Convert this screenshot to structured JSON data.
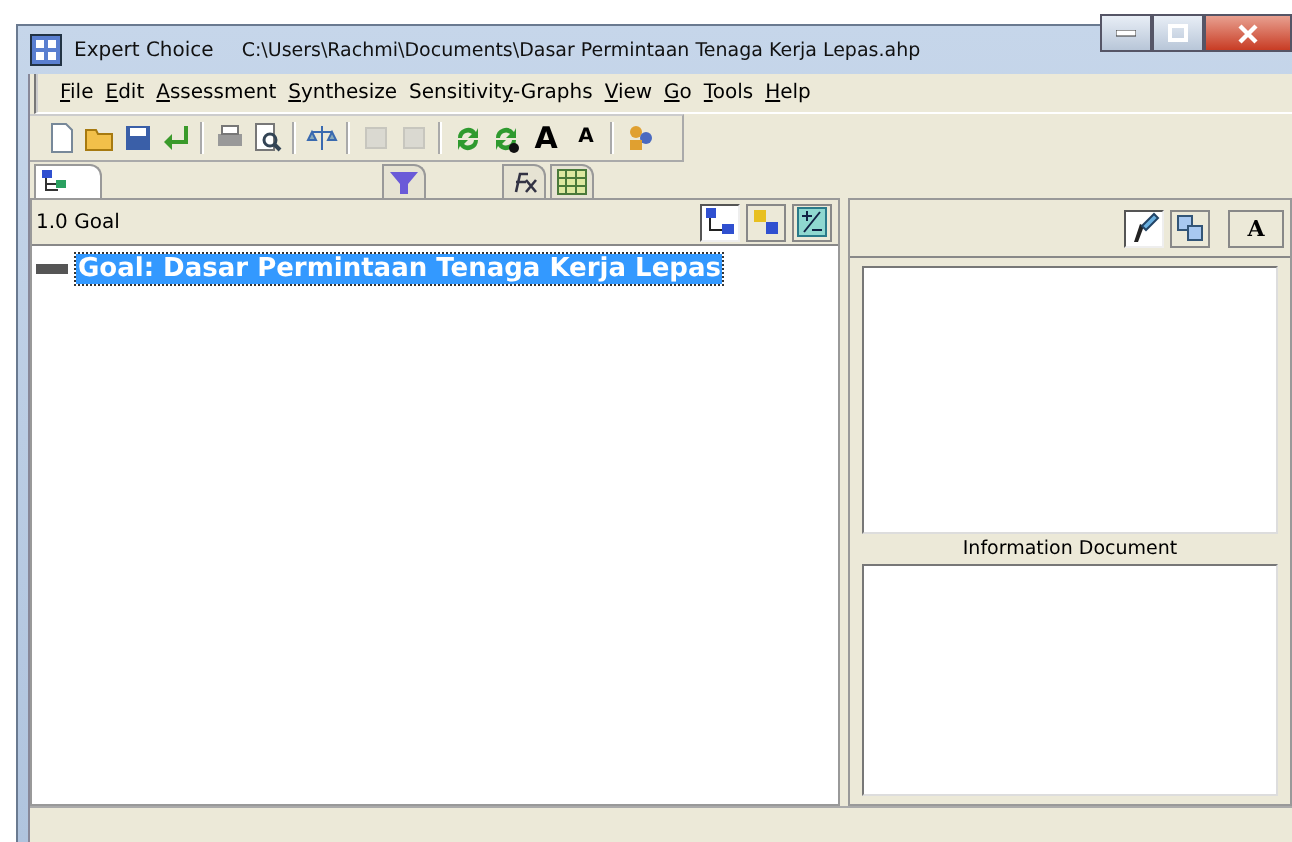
{
  "window": {
    "title": "Expert Choice",
    "path": "C:\\Users\\Rachmi\\Documents\\Dasar Permintaan Tenaga Kerja Lepas.ahp"
  },
  "menu": [
    {
      "key": "F",
      "after": "ile"
    },
    {
      "key": "E",
      "after": "dit"
    },
    {
      "key": "A",
      "after": "ssessment"
    },
    {
      "key": "S",
      "after": "ynthesize"
    },
    {
      "before": "Sensitivit",
      "key": "y",
      "after": "-Graphs"
    },
    {
      "key": "V",
      "after": "iew"
    },
    {
      "key": "G",
      "after": "o"
    },
    {
      "key": "T",
      "after": "ools"
    },
    {
      "key": "H",
      "after": "elp"
    }
  ],
  "toolbar": [
    {
      "kind": "new",
      "disabled": false
    },
    {
      "kind": "open",
      "disabled": false
    },
    {
      "kind": "save",
      "disabled": false
    },
    {
      "kind": "enter",
      "disabled": false
    },
    {
      "kind": "sep"
    },
    {
      "kind": "print",
      "disabled": false
    },
    {
      "kind": "preview",
      "disabled": false
    },
    {
      "kind": "sep"
    },
    {
      "kind": "balance",
      "disabled": false
    },
    {
      "kind": "sep"
    },
    {
      "kind": "cut",
      "disabled": true
    },
    {
      "kind": "paste",
      "disabled": true
    },
    {
      "kind": "sep"
    },
    {
      "kind": "refresh",
      "disabled": false
    },
    {
      "kind": "refresh2",
      "disabled": false
    },
    {
      "kind": "font",
      "glyph": "A",
      "big": true,
      "disabled": false
    },
    {
      "kind": "font",
      "glyph": "A",
      "big": false,
      "disabled": false
    },
    {
      "kind": "sep"
    },
    {
      "kind": "users",
      "disabled": false
    }
  ],
  "tabs": [
    {
      "kind": "tree",
      "selected": true
    },
    {
      "kind": "funnel",
      "selected": false
    },
    {
      "kind": "formula",
      "selected": false
    },
    {
      "kind": "grid",
      "selected": false
    }
  ],
  "left": {
    "node_label": "1.0 Goal",
    "buttons": [
      {
        "kind": "tree",
        "pressed": true
      },
      {
        "kind": "nodes",
        "pressed": false
      },
      {
        "kind": "plus",
        "pressed": false
      }
    ],
    "goal": {
      "text": "Goal: Dasar Permintaan Tenaga Kerja Lepas",
      "selected": true
    }
  },
  "right": {
    "buttons": [
      {
        "kind": "edit",
        "pressed": true
      },
      {
        "kind": "expand",
        "pressed": false
      },
      {
        "kind": "fontup",
        "glyph": "A",
        "pressed": false
      }
    ],
    "info_label": "Information Document"
  }
}
